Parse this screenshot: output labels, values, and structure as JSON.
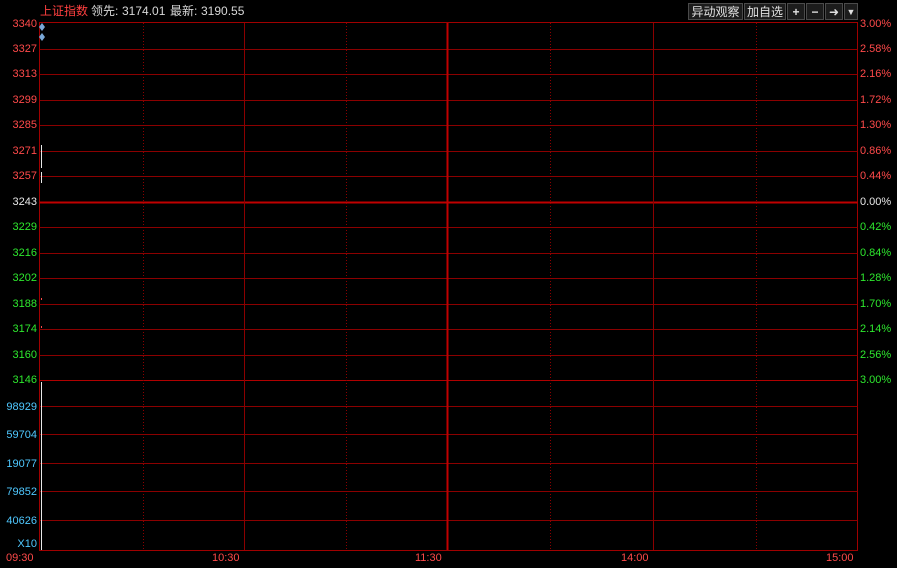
{
  "header": {
    "title": "上证指数",
    "lead_label": "领先:",
    "lead_value": "3174.01",
    "last_label": "最新:",
    "last_value": "3190.55"
  },
  "toolbar": {
    "abnormal_label": "异动观察",
    "watchlist_label": "加自选",
    "zoom_in_icon": "+",
    "zoom_out_icon": "−",
    "expand_icon": "➜",
    "menu_icon": "▼"
  },
  "price_axis": {
    "labels": [
      "3340",
      "3327",
      "3313",
      "3299",
      "3285",
      "3271",
      "3257",
      "3243",
      "3229",
      "3216",
      "3202",
      "3188",
      "3174",
      "3160",
      "3146"
    ],
    "percent_labels": [
      "3.00%",
      "2.58%",
      "2.16%",
      "1.72%",
      "1.30%",
      "0.86%",
      "0.44%",
      "0.00%",
      "0.42%",
      "0.84%",
      "1.28%",
      "1.70%",
      "2.14%",
      "2.56%",
      "3.00%"
    ]
  },
  "volume_axis": {
    "labels": [
      "98929",
      "59704",
      "19077",
      "79852",
      "40626"
    ],
    "multiplier": "X10"
  },
  "time_axis": {
    "labels": [
      "09:30",
      "10:30",
      "11:30",
      "14:00",
      "15:00"
    ]
  },
  "colors": {
    "up": "#ff4a4a",
    "down": "#2ee82e",
    "flat": "#e8e8e8",
    "volume": "#4fc8ff",
    "grid": "#8b0000"
  }
}
